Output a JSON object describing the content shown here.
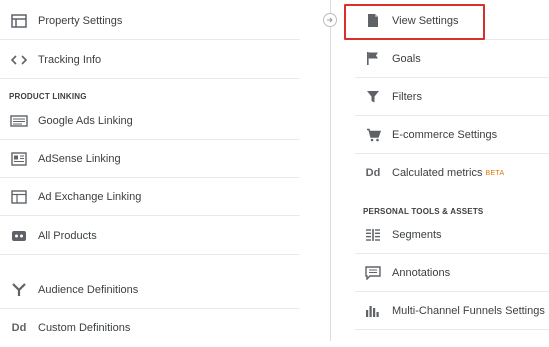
{
  "left": {
    "property_settings": "Property Settings",
    "tracking_info": "Tracking Info",
    "section_product_linking": "PRODUCT LINKING",
    "google_ads_linking": "Google Ads Linking",
    "adsense_linking": "AdSense Linking",
    "ad_exchange_linking": "Ad Exchange Linking",
    "all_products": "All Products",
    "audience_definitions": "Audience Definitions",
    "custom_definitions": "Custom Definitions"
  },
  "right": {
    "view_settings": "View Settings",
    "goals": "Goals",
    "filters": "Filters",
    "ecommerce_settings": "E-commerce Settings",
    "calculated_metrics": "Calculated metrics",
    "beta_badge": "BETA",
    "section_personal_tools": "PERSONAL TOOLS & ASSETS",
    "segments": "Segments",
    "annotations": "Annotations",
    "multi_channel_funnels": "Multi-Channel Funnels Settings"
  },
  "icon_dd_label": "Dd",
  "colors": {
    "highlight": "#d9312a",
    "beta": "#e37400",
    "divider": "#e8eaed",
    "icon": "#5f6368"
  }
}
